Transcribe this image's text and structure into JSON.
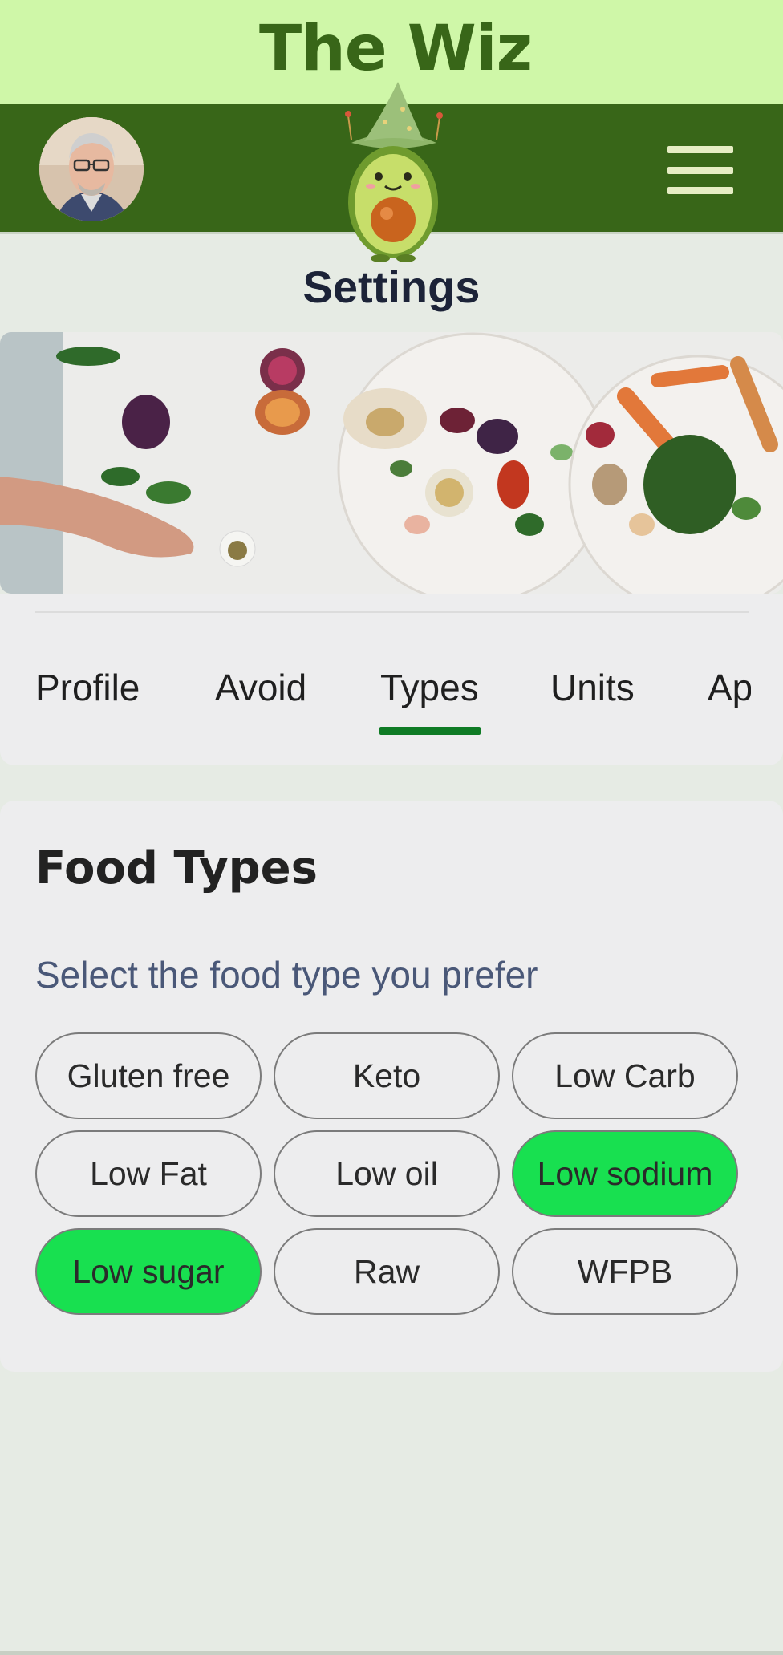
{
  "brand": {
    "title": "The Wiz"
  },
  "header": {
    "menu_icon": "hamburger-menu-icon",
    "colors": {
      "brand_bar": "#cff7a8",
      "header": "#386618"
    }
  },
  "page": {
    "title": "Settings"
  },
  "tabs": {
    "items": [
      {
        "label": "Profile"
      },
      {
        "label": "Avoid"
      },
      {
        "label": "Types",
        "active": true
      },
      {
        "label": "Units"
      },
      {
        "label": "Ap"
      }
    ],
    "active_color": "#0f7b25"
  },
  "food_types": {
    "heading": "Food Types",
    "subheading": "Select the food type you prefer",
    "options": [
      {
        "label": "Gluten free",
        "selected": false
      },
      {
        "label": "Keto",
        "selected": false
      },
      {
        "label": "Low Carb",
        "selected": false
      },
      {
        "label": "Low Fat",
        "selected": false
      },
      {
        "label": "Low oil",
        "selected": false
      },
      {
        "label": "Low sodium",
        "selected": true
      },
      {
        "label": "Low sugar",
        "selected": true
      },
      {
        "label": "Raw",
        "selected": false
      },
      {
        "label": "WFPB",
        "selected": false
      }
    ],
    "selected_color": "#18e050"
  }
}
